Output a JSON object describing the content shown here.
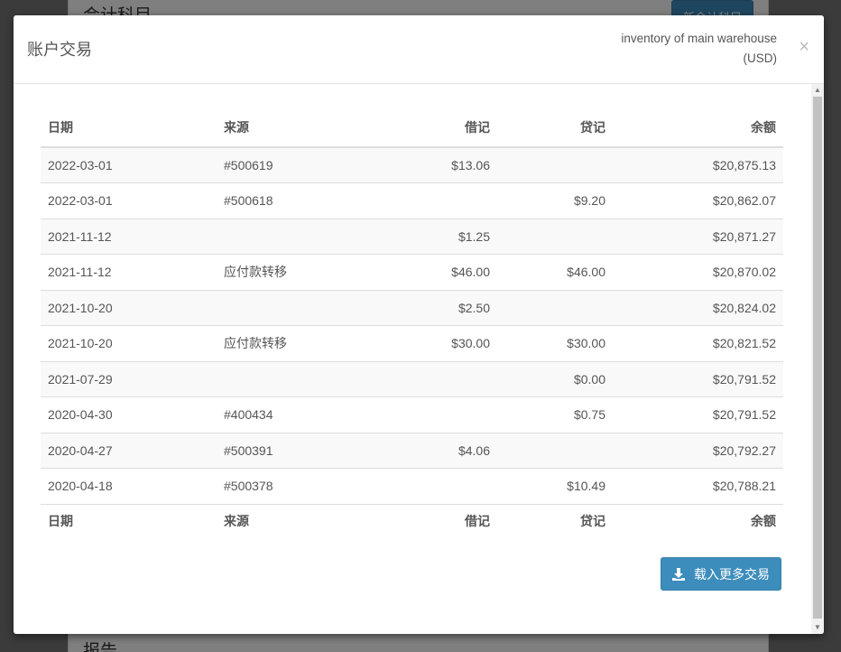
{
  "background": {
    "title": "会计科目",
    "button_label": "新会计科目",
    "report_title": "报告"
  },
  "modal": {
    "title": "账户交易",
    "account_name": "inventory of main warehouse",
    "currency": "(USD)",
    "close_symbol": "×"
  },
  "table": {
    "headers": {
      "date": "日期",
      "source": "来源",
      "debit": "借记",
      "credit": "贷记",
      "balance": "余额"
    },
    "rows": [
      {
        "date": "2022-03-01",
        "source": "#500619",
        "debit": "$13.06",
        "credit": "",
        "balance": "$20,875.13"
      },
      {
        "date": "2022-03-01",
        "source": "#500618",
        "debit": "",
        "credit": "$9.20",
        "balance": "$20,862.07"
      },
      {
        "date": "2021-11-12",
        "source": "",
        "debit": "$1.25",
        "credit": "",
        "balance": "$20,871.27"
      },
      {
        "date": "2021-11-12",
        "source": "应付款转移",
        "debit": "$46.00",
        "credit": "$46.00",
        "balance": "$20,870.02"
      },
      {
        "date": "2021-10-20",
        "source": "",
        "debit": "$2.50",
        "credit": "",
        "balance": "$20,824.02"
      },
      {
        "date": "2021-10-20",
        "source": "应付款转移",
        "debit": "$30.00",
        "credit": "$30.00",
        "balance": "$20,821.52"
      },
      {
        "date": "2021-07-29",
        "source": "",
        "debit": "",
        "credit": "$0.00",
        "balance": "$20,791.52"
      },
      {
        "date": "2020-04-30",
        "source": "#400434",
        "debit": "",
        "credit": "$0.75",
        "balance": "$20,791.52"
      },
      {
        "date": "2020-04-27",
        "source": "#500391",
        "debit": "$4.06",
        "credit": "",
        "balance": "$20,792.27"
      },
      {
        "date": "2020-04-18",
        "source": "#500378",
        "debit": "",
        "credit": "$10.49",
        "balance": "$20,788.21"
      }
    ]
  },
  "load_more": {
    "label": "载入更多交易",
    "icon": "download-icon"
  },
  "colors": {
    "primary": "#3c8dbc",
    "stripe": "#f9f9f9"
  }
}
